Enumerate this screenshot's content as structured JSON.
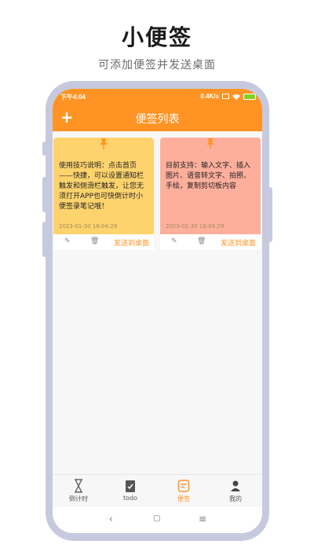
{
  "promo": {
    "title": "小便签",
    "subtitle": "可添加便签并发送桌面"
  },
  "status_bar": {
    "time": "下午4:04",
    "net_speed": "0.4K/s",
    "battery": "100"
  },
  "app_bar": {
    "title": "便签列表",
    "add_icon": "+"
  },
  "notes": [
    {
      "text": "使用技巧说明：点击首页——快捷，可以设置通知栏触发和侧滑栏触发，让您无须打开APP也可快倒计时小便签录笔记哦！",
      "date": "2023-01-30 16:04:29",
      "color": "#fed36d",
      "send_label": "发送到桌面"
    },
    {
      "text": "目前支持：输入文字、插入图片、语音转文字、拍照、手绘，复制剪切板内容",
      "date": "2023-01-30 16:04:29",
      "color": "#feaf9c",
      "send_label": "发送到桌面"
    }
  ],
  "nav": [
    {
      "label": "倒计时",
      "icon": "hourglass-icon"
    },
    {
      "label": "todo",
      "icon": "clipboard-check-icon"
    },
    {
      "label": "便签",
      "icon": "note-icon",
      "active": true
    },
    {
      "label": "我的",
      "icon": "person-icon"
    }
  ],
  "system_nav": {
    "back": "‹",
    "home": "▢",
    "menu": "≡"
  },
  "colors": {
    "accent": "#ff9424",
    "frame": "#c7cade"
  }
}
